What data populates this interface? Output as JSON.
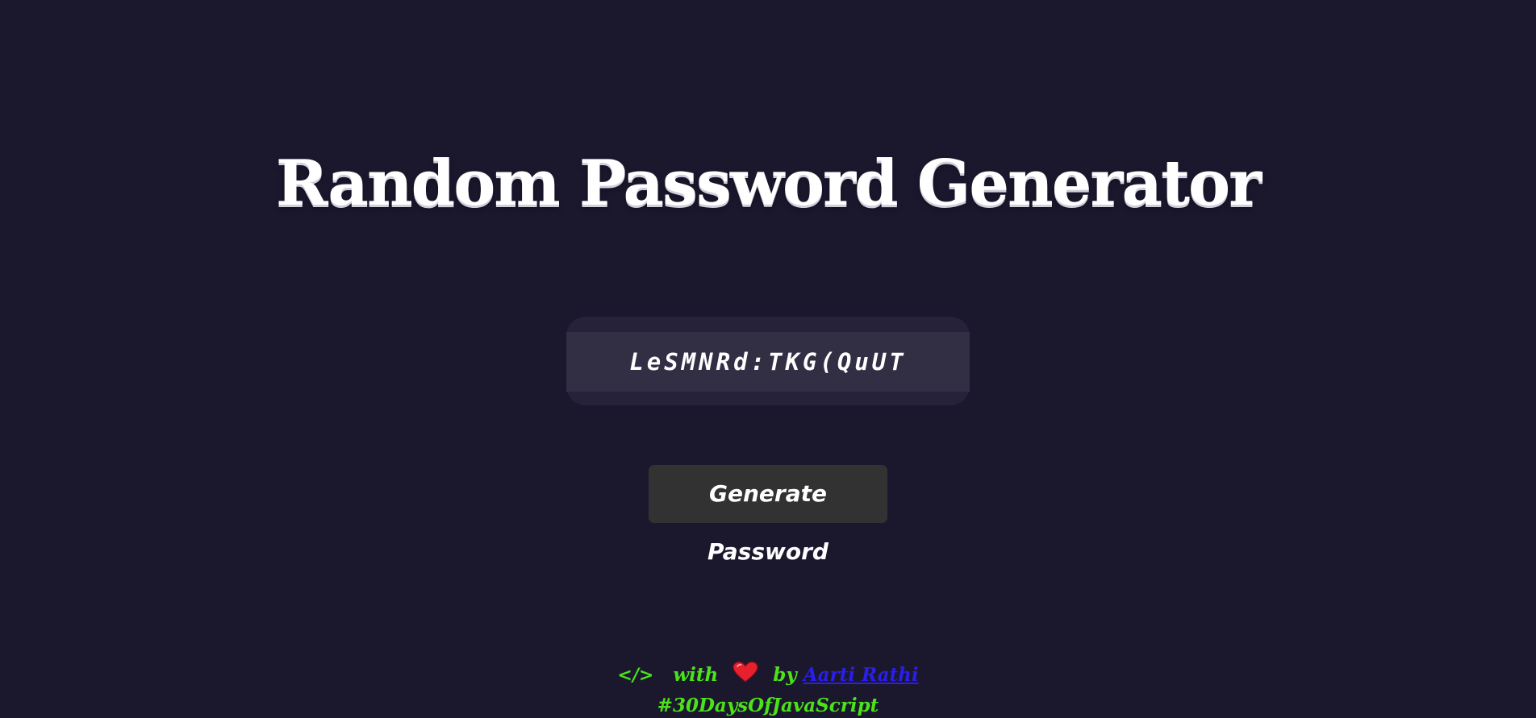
{
  "header": {
    "title": "Random Password Generator"
  },
  "password": {
    "value": "LeSMNRd:TKG(QuUT"
  },
  "generate_button": {
    "label": "Generate Password"
  },
  "footer": {
    "code_symbol": "</>",
    "with_text": "with",
    "by_text": "by",
    "author": "Aarti Rathi",
    "hashtag": "#30DaysOfJavaScript",
    "heart_icon": "heart-icon",
    "colors": {
      "text": "#4ce21a",
      "link": "#2a1ee8",
      "heart": "#e8202e"
    }
  },
  "colors": {
    "background": "#1b182e",
    "card": "#262239",
    "field": "#322e44",
    "button": "#323232"
  }
}
